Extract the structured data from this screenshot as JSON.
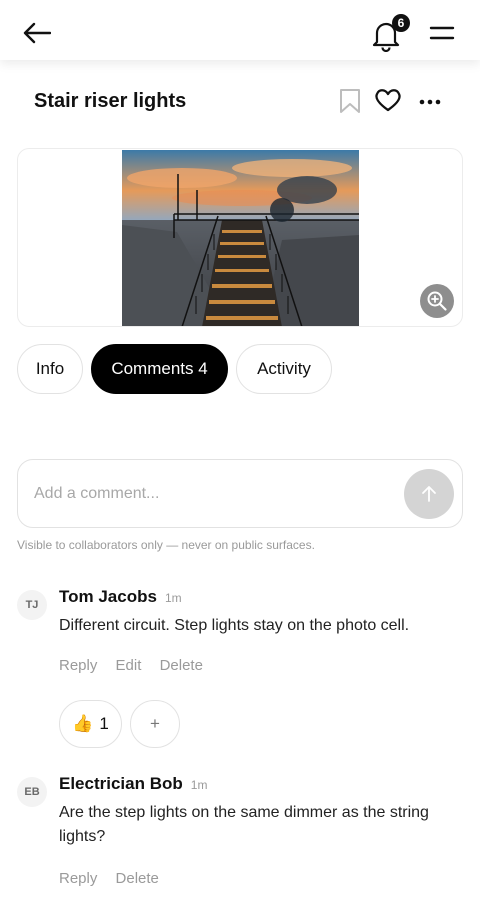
{
  "header": {
    "back_icon": "arrow-left-icon",
    "notifications_icon": "bell-icon",
    "notification_count": "6",
    "menu_icon": "hamburger-menu-icon"
  },
  "item": {
    "title": "Stair riser lights",
    "bookmark_icon": "bookmark-icon",
    "favorite_icon": "heart-icon",
    "more_icon": "more-dots-icon",
    "zoom_icon": "zoom-in-icon"
  },
  "tabs": [
    {
      "label": "Info",
      "active": false
    },
    {
      "label": "Comments 4",
      "active": true
    },
    {
      "label": "Activity",
      "active": false
    }
  ],
  "composer": {
    "placeholder": "Add a comment...",
    "send_icon": "arrow-up-icon",
    "note": "Visible to collaborators only — never on public surfaces."
  },
  "comments": [
    {
      "initials": "TJ",
      "author": "Tom Jacobs",
      "time": "1m",
      "text": "Different circuit. Step lights stay on the photo cell.",
      "actions": [
        "Reply",
        "Edit",
        "Delete"
      ],
      "reaction_emoji": "👍",
      "reaction_count": "1",
      "add_reaction": "+"
    },
    {
      "initials": "EB",
      "author": "Electrician Bob",
      "time": "1m",
      "text": "Are the step lights on the same dimmer as the string lights?",
      "actions": [
        "Reply",
        "Delete"
      ]
    }
  ],
  "colors": {
    "accent": "#000000",
    "muted": "#9a9a9a",
    "border": "#e2e2e2",
    "send_disabled": "#d4d4d4"
  }
}
